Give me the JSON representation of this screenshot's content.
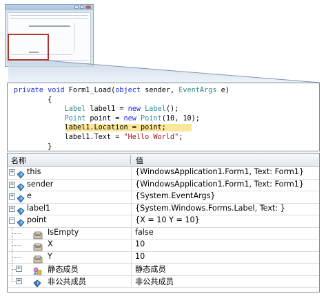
{
  "code": {
    "lines": [
      [
        {
          "t": "private",
          "c": "kw"
        },
        {
          "t": " "
        },
        {
          "t": "void",
          "c": "kw"
        },
        {
          "t": " Form1_Load("
        },
        {
          "t": "object",
          "c": "kw"
        },
        {
          "t": " sender, "
        },
        {
          "t": "EventArgs",
          "c": "ty"
        },
        {
          "t": " e)"
        }
      ],
      [
        {
          "t": "        {"
        }
      ],
      [
        {
          "t": "            "
        },
        {
          "t": "Label",
          "c": "ty"
        },
        {
          "t": " label1 = "
        },
        {
          "t": "new",
          "c": "kw"
        },
        {
          "t": " "
        },
        {
          "t": "Label",
          "c": "ty"
        },
        {
          "t": "();"
        }
      ],
      [
        {
          "t": "            "
        },
        {
          "t": "Point",
          "c": "ty"
        },
        {
          "t": " point = "
        },
        {
          "t": "new",
          "c": "kw"
        },
        {
          "t": " "
        },
        {
          "t": "Point",
          "c": "ty"
        },
        {
          "t": "(10, 10);"
        }
      ],
      [
        {
          "t": "            "
        },
        {
          "t": "label1.Location = point;      ",
          "c": "hl"
        }
      ],
      [
        {
          "t": "            label1.Text = "
        },
        {
          "t": "\"Hello World\"",
          "c": "st"
        },
        {
          "t": ";"
        }
      ],
      [
        {
          "t": "        }"
        }
      ]
    ]
  },
  "grid": {
    "header": {
      "name": "名称",
      "value": "值"
    },
    "rows": [
      {
        "name": "this",
        "value": "{WindowsApplication1.Form1, Text: Form1}",
        "icon": "field",
        "expander": "+",
        "level": 0
      },
      {
        "name": "sender",
        "value": "{WindowsApplication1.Form1, Text: Form1}",
        "icon": "field",
        "expander": "+",
        "level": 0
      },
      {
        "name": "e",
        "value": "{System.EventArgs}",
        "icon": "field",
        "expander": "+",
        "level": 0
      },
      {
        "name": "label1",
        "value": "{System.Windows.Forms.Label, Text: }",
        "icon": "field",
        "expander": "+",
        "level": 0
      },
      {
        "name": "point",
        "value": "{X = 10 Y = 10}",
        "icon": "field",
        "expander": "-",
        "level": 0
      },
      {
        "name": "IsEmpty",
        "value": "false",
        "icon": "property",
        "expander": "",
        "level": 1
      },
      {
        "name": "X",
        "value": "10",
        "icon": "property",
        "expander": "",
        "level": 1
      },
      {
        "name": "Y",
        "value": "10",
        "icon": "property",
        "expander": "",
        "level": 1
      },
      {
        "name": "静态成员",
        "value": "静态成员",
        "icon": "static-members",
        "expander": "+",
        "level": 1
      },
      {
        "name": "非公共成员",
        "value": "非公共成员",
        "icon": "nonpublic-members",
        "expander": "+",
        "level": 1
      }
    ]
  },
  "colors": {
    "highlight": "#fbe699",
    "keyword": "#1c2ad6",
    "type": "#2b8a8e",
    "string": "#a31515",
    "callout": "#b0352a"
  }
}
